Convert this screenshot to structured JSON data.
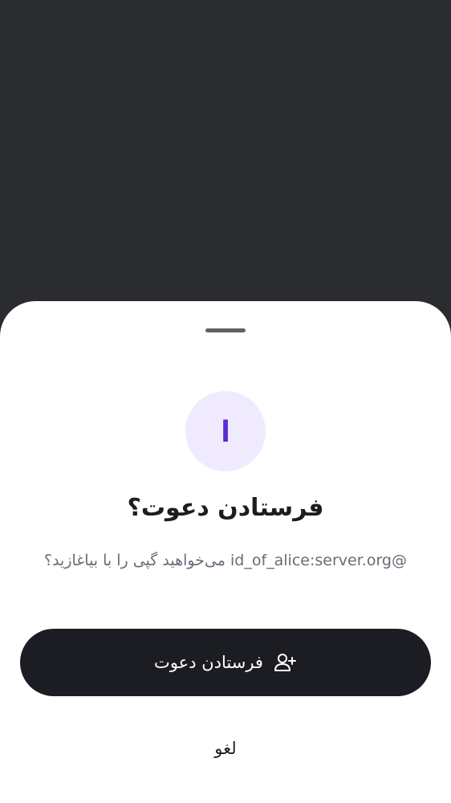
{
  "dialog": {
    "avatar_letter": "I",
    "title": "فرستادن دعوت؟",
    "message": "@id_of_alice:server.org می‌خواهید گپی را با بیاغازید؟",
    "invite_button_label": "فرستادن دعوت",
    "invite_button_icon": "user-add-icon",
    "cancel_label": "لغو"
  },
  "colors": {
    "backdrop": "#2b2c2f",
    "sheet": "#ffffff",
    "avatar_bg": "#efeafe",
    "avatar_letter": "#5b2bd6",
    "button_bg": "#1b1d22",
    "muted_text": "#656d77"
  }
}
